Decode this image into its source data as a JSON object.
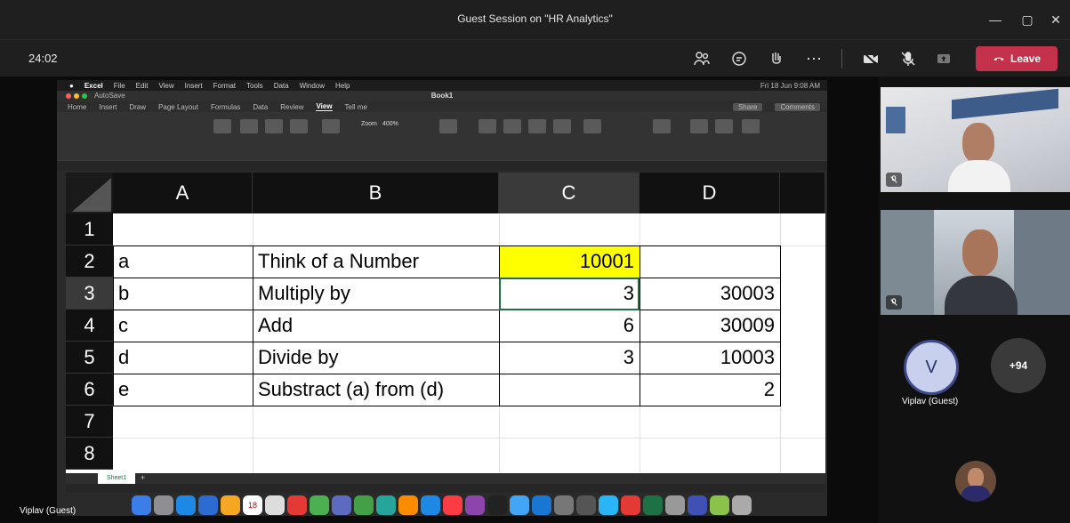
{
  "window": {
    "title": "Guest Session on \"HR Analytics\""
  },
  "meeting": {
    "timer": "24:02",
    "leave_label": "Leave",
    "controls": [
      "people-icon",
      "chat-icon",
      "reactions-icon",
      "more-icon",
      "camera-off-icon",
      "mic-off-icon",
      "share-icon"
    ]
  },
  "mac": {
    "menu": [
      "Excel",
      "File",
      "Edit",
      "View",
      "Insert",
      "Format",
      "Tools",
      "Data",
      "Window",
      "Help"
    ],
    "clock": "Fri 18 Jun 9:08 AM",
    "book_title": "Book1",
    "autosave": "AutoSave",
    "ribbon_tabs": [
      "Home",
      "Insert",
      "Draw",
      "Page Layout",
      "Formulas",
      "Data",
      "Review",
      "View",
      "Tell me"
    ],
    "active_tab": "View",
    "share_label": "Share",
    "comments_label": "Comments",
    "zoom_label": "Zoom",
    "zoom_value": "400%",
    "sheet_tab": "Sheet1"
  },
  "sheet": {
    "columns": [
      "A",
      "B",
      "C",
      "D"
    ],
    "selected_column": "C",
    "rows": [
      "1",
      "2",
      "3",
      "4",
      "5",
      "6",
      "7",
      "8"
    ],
    "selected_row": "3",
    "cells": {
      "A2": "a",
      "B2": "Think of a Number",
      "C2": "10001",
      "A3": "b",
      "B3": "Multiply by",
      "C3": "3",
      "D3": "30003",
      "A4": "c",
      "B4": "Add",
      "C4": "6",
      "D4": "30009",
      "A5": "d",
      "B5": "Divide by",
      "C5": "3",
      "D5": "10003",
      "A6": "e",
      "B6": "Substract (a) from (d)",
      "D6": "2"
    },
    "highlight_color": "#ffff00"
  },
  "presenter": {
    "name": "Viplav (Guest)"
  },
  "participants": {
    "avatar_initial": "V",
    "avatar_name": "Viplav (Guest)",
    "overflow_count": "+94"
  },
  "colors": {
    "leave": "#c4314b",
    "teams_bg": "#1f1f1f"
  }
}
